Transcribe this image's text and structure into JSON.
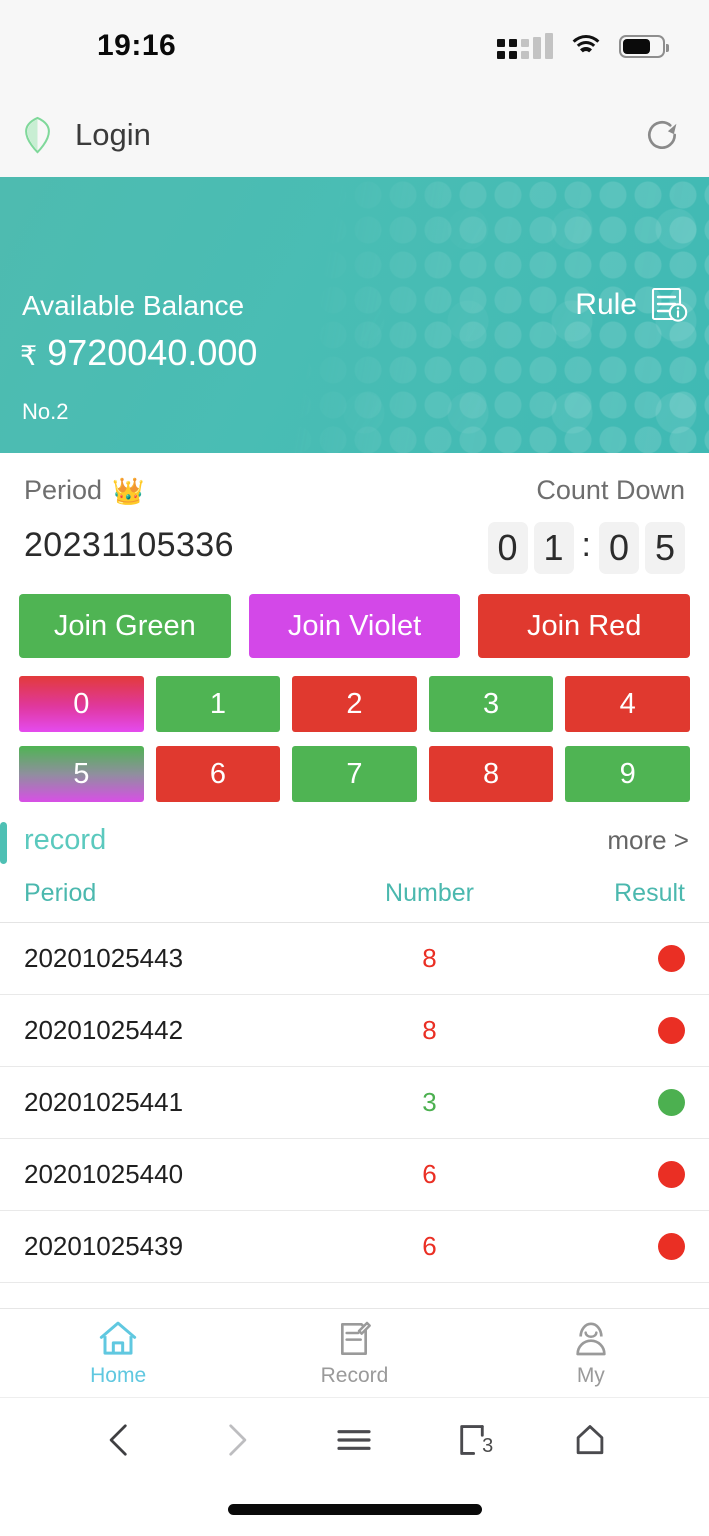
{
  "status_bar": {
    "time": "19:16",
    "signal_icon": "signal-icon",
    "wifi_icon": "wifi-icon",
    "battery_icon": "battery-icon",
    "battery_level_percent": 72
  },
  "app_header": {
    "logo_icon": "shield-icon",
    "title": "Login",
    "refresh_icon": "refresh-icon"
  },
  "balance_card": {
    "label": "Available Balance",
    "currency_symbol": "₹",
    "amount": "9720040.000",
    "account_no": "No.2",
    "rule_label": "Rule",
    "rule_icon": "rule-document-info-icon",
    "accent_color": "#46b8ad"
  },
  "period_section": {
    "period_label": "Period",
    "crown_icon": "crown-icon",
    "period_value": "20231105336",
    "countdown_label": "Count Down",
    "countdown_digits": [
      "0",
      "1",
      "0",
      "5"
    ],
    "countdown_separator": ":"
  },
  "join_buttons": [
    {
      "label": "Join Green",
      "color": "#4fb453"
    },
    {
      "label": "Join Violet",
      "color": "#d348e8"
    },
    {
      "label": "Join Red",
      "color": "#e0392f"
    }
  ],
  "number_buttons": [
    {
      "label": "0",
      "style": "gradient-red-violet"
    },
    {
      "label": "1",
      "style": "green"
    },
    {
      "label": "2",
      "style": "red"
    },
    {
      "label": "3",
      "style": "green"
    },
    {
      "label": "4",
      "style": "red"
    },
    {
      "label": "5",
      "style": "gradient-green-violet"
    },
    {
      "label": "6",
      "style": "red"
    },
    {
      "label": "7",
      "style": "green"
    },
    {
      "label": "8",
      "style": "red"
    },
    {
      "label": "9",
      "style": "green"
    }
  ],
  "record_section": {
    "title": "record",
    "more_label": "more >",
    "columns": {
      "period": "Period",
      "number": "Number",
      "result": "Result"
    },
    "rows": [
      {
        "period": "20201025443",
        "number": "8",
        "result_color": "#ea2f24",
        "number_color": "#ea2f24"
      },
      {
        "period": "20201025442",
        "number": "8",
        "result_color": "#ea2f24",
        "number_color": "#ea2f24"
      },
      {
        "period": "20201025441",
        "number": "3",
        "result_color": "#4cb050",
        "number_color": "#4cb050"
      },
      {
        "period": "20201025440",
        "number": "6",
        "result_color": "#ea2f24",
        "number_color": "#ea2f24"
      },
      {
        "period": "20201025439",
        "number": "6",
        "result_color": "#ea2f24",
        "number_color": "#ea2f24"
      }
    ]
  },
  "tab_bar": {
    "active_color": "#60c8e0",
    "inactive_color": "#9a9a9a",
    "tabs": [
      {
        "label": "Home",
        "icon": "home-icon",
        "active": true
      },
      {
        "label": "Record",
        "icon": "record-icon",
        "active": false
      },
      {
        "label": "My",
        "icon": "person-icon",
        "active": false
      }
    ]
  },
  "browser_bar": {
    "back_icon": "chevron-left-icon",
    "forward_icon": "chevron-right-icon",
    "menu_icon": "hamburger-menu-icon",
    "tabs_icon": "browser-tabs-icon",
    "tabs_count": "3",
    "home_icon": "browser-home-icon"
  }
}
